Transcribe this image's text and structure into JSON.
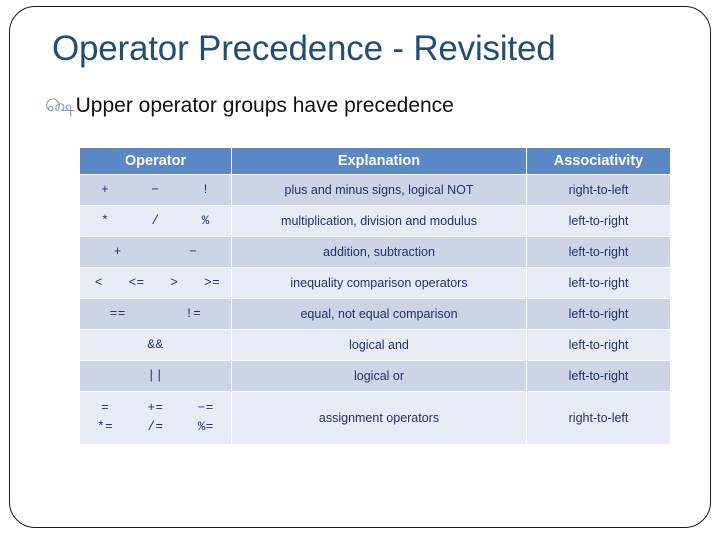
{
  "slide": {
    "title": "Operator Precedence - Revisited",
    "bullet_icon": "decorative-ornament-bullet",
    "bullet_glyph": "௸",
    "bullet_text": "Upper operator groups have precedence",
    "title_color": "#1F4E79",
    "header_fill": "#5B87C5",
    "row_shade_dark": "#ccd4e6",
    "row_shade_light": "#e7ebf5",
    "body_text_color": "#21336b"
  },
  "table": {
    "headers": {
      "operator": "Operator",
      "explanation": "Explanation",
      "associativity": "Associativity"
    },
    "rows": [
      {
        "operators": [
          "+",
          "−",
          "!"
        ],
        "operators2": [],
        "explanation": "plus and minus signs, logical NOT",
        "associativity": "right-to-left"
      },
      {
        "operators": [
          "*",
          "/",
          "%"
        ],
        "operators2": [],
        "explanation": "multiplication, division and modulus",
        "associativity": "left-to-right"
      },
      {
        "operators": [
          "+",
          "−"
        ],
        "operators2": [],
        "explanation": "addition, subtraction",
        "associativity": "left-to-right"
      },
      {
        "operators": [
          "<",
          "<=",
          ">",
          ">="
        ],
        "operators2": [],
        "explanation": "inequality comparison operators",
        "associativity": "left-to-right"
      },
      {
        "operators": [
          "==",
          "!="
        ],
        "operators2": [],
        "explanation": "equal,  not equal comparison",
        "associativity": "left-to-right"
      },
      {
        "operators": [
          "&&"
        ],
        "operators2": [],
        "explanation": "logical and",
        "associativity": "left-to-right"
      },
      {
        "operators": [
          "||"
        ],
        "operators2": [],
        "explanation": "logical or",
        "associativity": "left-to-right"
      },
      {
        "operators": [
          "=",
          "+=",
          "−="
        ],
        "operators2": [
          "*=",
          "/=",
          "%="
        ],
        "explanation": "assignment operators",
        "associativity": "right-to-left"
      }
    ]
  }
}
